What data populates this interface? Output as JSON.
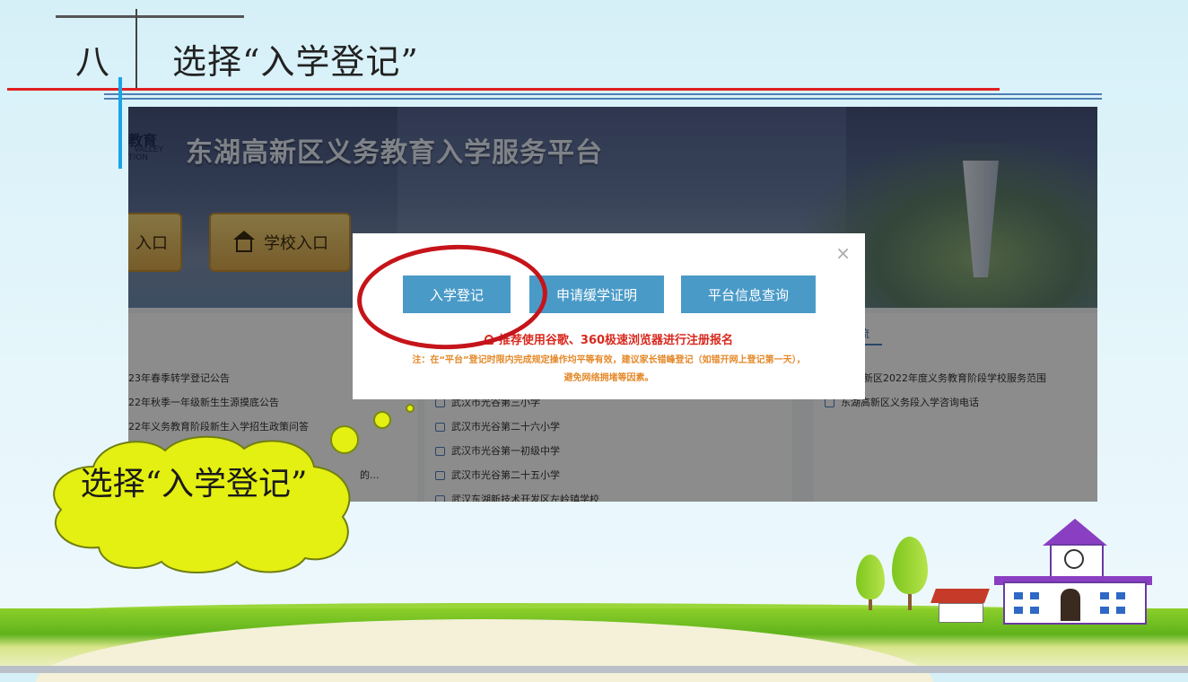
{
  "slide": {
    "section_number": "八",
    "title": "选择“入学登记”",
    "bubble_text": "选择“入学登记”"
  },
  "site": {
    "logo_text": "教育",
    "logo_sub1": "VALLEY",
    "logo_sub2": "TION",
    "title": "东湖高新区义务教育入学服务平台",
    "entry_buttons": [
      "入口",
      "学校入口"
    ],
    "left_list": [
      "23年春季转学登记公告",
      "22年秋季一年级新生生源摸底公告",
      "22年义务教育阶段新生入学招生政策问答",
      "的..."
    ],
    "middle_list": [
      "武汉市光谷第三小学",
      "武汉市光谷第二十六小学",
      "武汉市光谷第一初级中学",
      "武汉市光谷第二十五小学",
      "武汉东湖新技术开发区左岭镇学校"
    ],
    "right_header": "流",
    "right_list": [
      "高新区2022年度义务教育阶段学校服务范围",
      "东湖高新区义务段入学咨询电话"
    ]
  },
  "modal": {
    "close": "×",
    "buttons": [
      "入学登记",
      "申请缓学证明",
      "平台信息查询"
    ],
    "recommend": "推荐使用谷歌、360极速浏览器进行注册报名",
    "note_line1": "注：在“平台”登记时限内完成规定操作均平等有效，建议家长错峰登记（如错开网上登记第一天），",
    "note_line2": "避免网络拥堵等因素。"
  },
  "colors": {
    "accent_red": "#e02020",
    "modal_button": "#4a9ac8",
    "recommend_text": "#d8281e",
    "note_text": "#e4892a",
    "bubble_fill": "#e4ef12"
  }
}
